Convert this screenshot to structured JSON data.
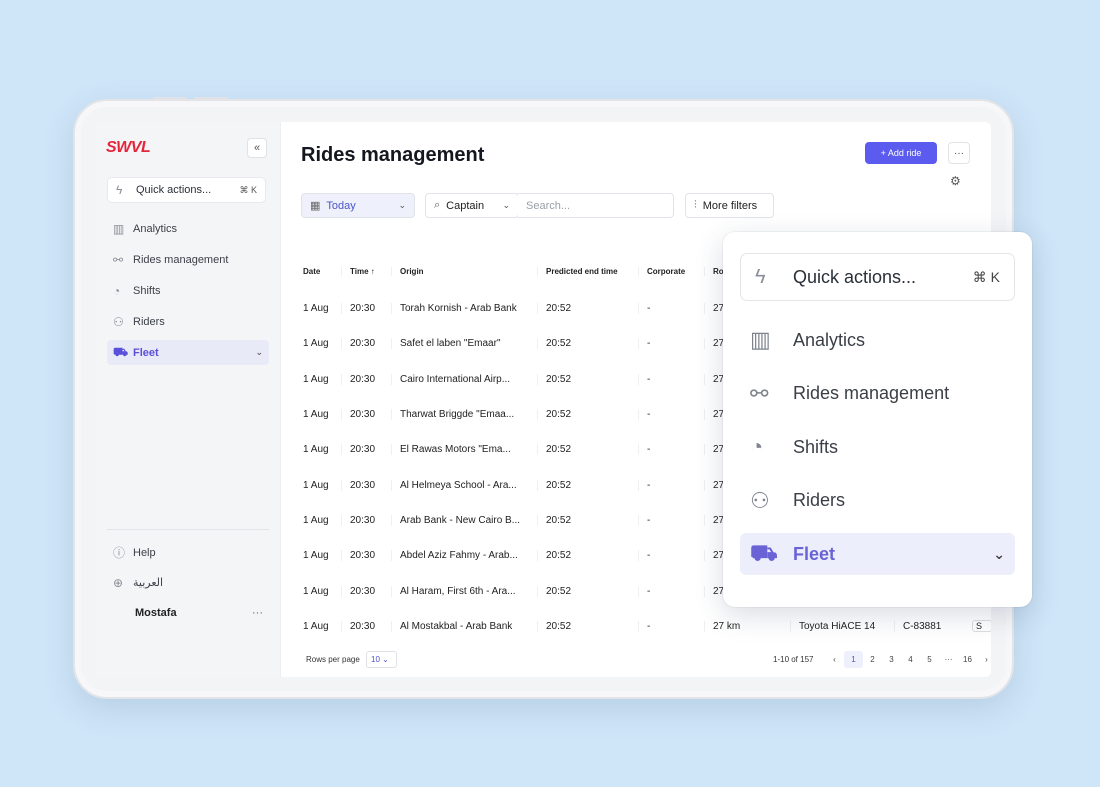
{
  "brand": {
    "logo_text": "SWVL",
    "accent": "#5b5bf0",
    "logo_color": "#e4253b"
  },
  "sidebar": {
    "collapse_icon": "chevrons-left-icon",
    "quick_actions": {
      "label": "Quick actions...",
      "shortcut": "⌘ K",
      "icon": "bolt-icon"
    },
    "items": [
      {
        "label": "Analytics",
        "icon": "analytics-icon"
      },
      {
        "label": "Rides management",
        "icon": "route-icon"
      },
      {
        "label": "Shifts",
        "icon": "clock-icon"
      },
      {
        "label": "Riders",
        "icon": "users-icon"
      },
      {
        "label": "Fleet",
        "icon": "bus-icon",
        "active": true
      }
    ],
    "bottom": [
      {
        "label": "Help",
        "icon": "help-icon"
      },
      {
        "label": "العربية",
        "icon": "globe-icon"
      }
    ],
    "user": {
      "name": "Mostafa",
      "menu": "···"
    }
  },
  "header": {
    "title": "Rides management",
    "add_button": "+ Add ride",
    "more_button": "···"
  },
  "filters": {
    "date": "Today",
    "captain": "Captain",
    "search_placeholder": "Search...",
    "more_filters": "More filters"
  },
  "table": {
    "columns": [
      "Date",
      "Time ↑",
      "Origin",
      "Predicted end time",
      "Corporate",
      "Ro"
    ],
    "rows": [
      {
        "date": "1 Aug",
        "time": "20:30",
        "origin": "Torah Kornish - Arab Bank",
        "pet": "20:52",
        "corp": "-",
        "route": "27"
      },
      {
        "date": "1 Aug",
        "time": "20:30",
        "origin": "Safet el laben  \"Emaar\"",
        "pet": "20:52",
        "corp": "-",
        "route": "27"
      },
      {
        "date": "1 Aug",
        "time": "20:30",
        "origin": "Cairo International Airp...",
        "pet": "20:52",
        "corp": "-",
        "route": "27"
      },
      {
        "date": "1 Aug",
        "time": "20:30",
        "origin": "Tharwat Briggde \"Emaa...",
        "pet": "20:52",
        "corp": "-",
        "route": "27"
      },
      {
        "date": "1 Aug",
        "time": "20:30",
        "origin": "El Rawas Motors  \"Ema...",
        "pet": "20:52",
        "corp": "-",
        "route": "27"
      },
      {
        "date": "1 Aug",
        "time": "20:30",
        "origin": "Al Helmeya School - Ara...",
        "pet": "20:52",
        "corp": "-",
        "route": "27"
      },
      {
        "date": "1 Aug",
        "time": "20:30",
        "origin": "Arab Bank - New Cairo B...",
        "pet": "20:52",
        "corp": "-",
        "route": "27"
      },
      {
        "date": "1 Aug",
        "time": "20:30",
        "origin": "Abdel Aziz Fahmy - Arab...",
        "pet": "20:52",
        "corp": "-",
        "route": "27"
      },
      {
        "date": "1 Aug",
        "time": "20:30",
        "origin": "Al Haram, First 6th - Ara...",
        "pet": "20:52",
        "corp": "-",
        "route": "27"
      },
      {
        "date": "1 Aug",
        "time": "20:30",
        "origin": "Al Mostakbal - Arab Bank",
        "pet": "20:52",
        "corp": "-",
        "route": "27 km",
        "vehicle": "Toyota HiACE 14",
        "plate": "C-83881",
        "status": "S"
      }
    ]
  },
  "footer": {
    "rows_per_page_label": "Rows per page",
    "rows_per_page": "10",
    "range": "1-10 of 157",
    "pages": [
      "‹",
      "1",
      "2",
      "3",
      "4",
      "5",
      "···",
      "16",
      "›"
    ],
    "active_page": "1"
  },
  "popup": {
    "quick_actions": {
      "label": "Quick actions...",
      "shortcut": "⌘ K"
    },
    "items": [
      {
        "label": "Analytics"
      },
      {
        "label": "Rides management"
      },
      {
        "label": "Shifts"
      },
      {
        "label": "Riders"
      },
      {
        "label": "Fleet",
        "active": true
      }
    ]
  }
}
